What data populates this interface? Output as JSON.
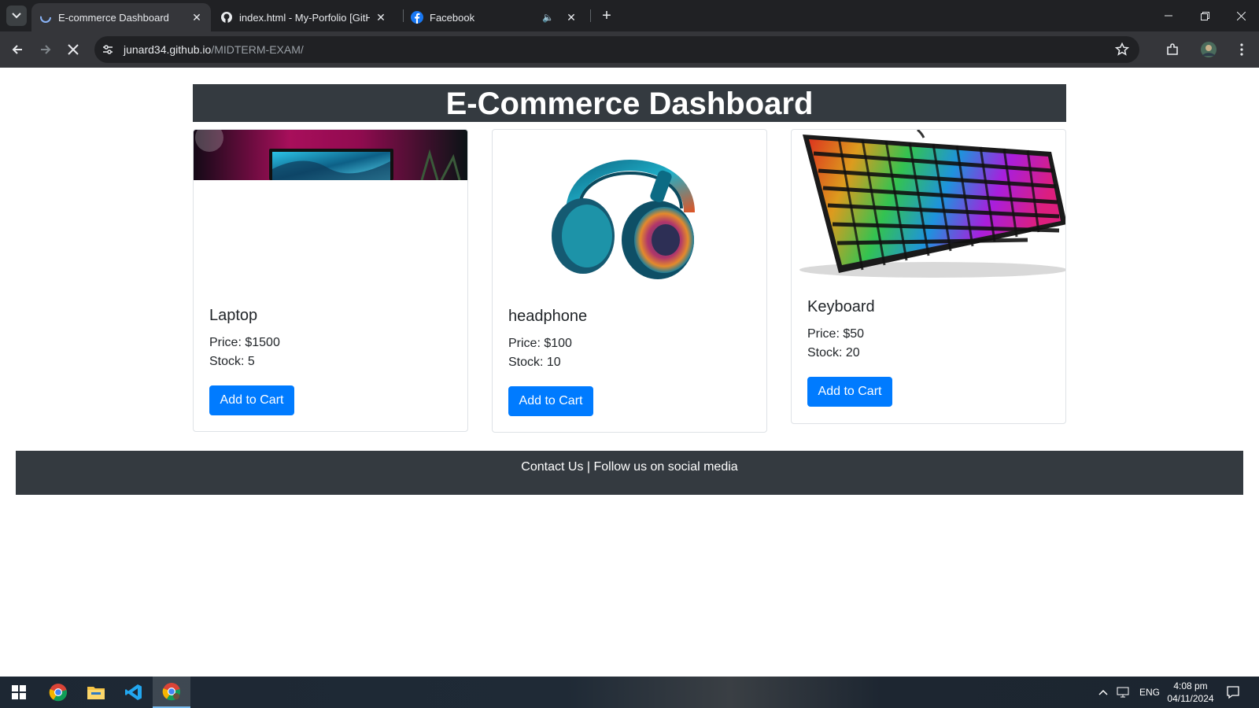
{
  "browser": {
    "tabs": [
      {
        "title": "E-commerce Dashboard",
        "icon": "loading-icon",
        "active": true
      },
      {
        "title": "index.html - My-Porfolio [GitHu",
        "icon": "github-icon",
        "active": false
      },
      {
        "title": "Facebook",
        "icon": "facebook-icon",
        "active": false,
        "audio": true
      }
    ],
    "url_host": "junard34.github.io",
    "url_path": "/MIDTERM-EXAM/"
  },
  "page": {
    "title": "E-Commerce Dashboard",
    "products": [
      {
        "name": "Laptop",
        "price": "Price: $1500",
        "stock": "Stock: 5",
        "button": "Add to Cart"
      },
      {
        "name": "headphone",
        "price": "Price: $100",
        "stock": "Stock: 10",
        "button": "Add to Cart"
      },
      {
        "name": "Keyboard",
        "price": "Price: $50",
        "stock": "Stock: 20",
        "button": "Add to Cart"
      }
    ],
    "footer": "Contact Us | Follow us on social media"
  },
  "taskbar": {
    "language": "ENG",
    "time": "4:08 pm",
    "date": "04/11/2024"
  },
  "colors": {
    "header_bg": "#343a40",
    "button": "#007bff",
    "browser_dark": "#202124"
  }
}
